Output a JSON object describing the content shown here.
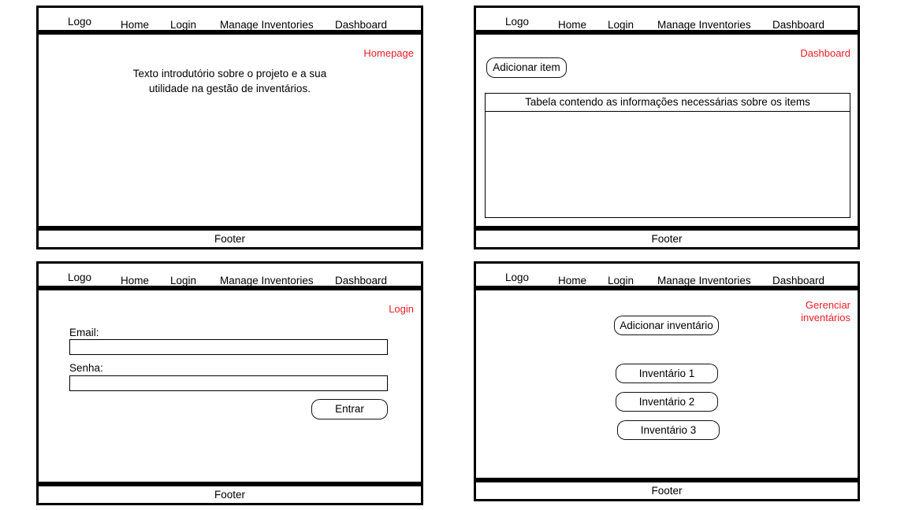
{
  "meta": {
    "accent_red": "#ee1c25",
    "line_color": "#000000",
    "background": "#ffffff"
  },
  "nav": {
    "logo": "Logo",
    "links": [
      "Home",
      "Login",
      "Manage Inventories",
      "Dashboard"
    ]
  },
  "footer": {
    "label": "Footer"
  },
  "screens": {
    "homepage": {
      "tag": "Homepage",
      "intro_text": "Texto introdutório sobre o projeto e a sua\nutilidade na gestão de inventários."
    },
    "dashboard": {
      "tag": "Dashboard",
      "add_item_button": "Adicionar item",
      "table": {
        "header": "Tabela contendo as informações necessárias sobre os items",
        "rows": []
      }
    },
    "login": {
      "tag": "Login",
      "email_label": "Email:",
      "email_value": "",
      "email_placeholder": "",
      "password_label": "Senha:",
      "password_value": "",
      "password_placeholder": "",
      "submit_button": "Entrar"
    },
    "manage_inventories": {
      "tag": "Gerenciar\ninventários",
      "add_inventory_button": "Adicionar inventário",
      "inventories": [
        "Inventário 1",
        "Inventário 2",
        "Inventário 3"
      ]
    }
  }
}
